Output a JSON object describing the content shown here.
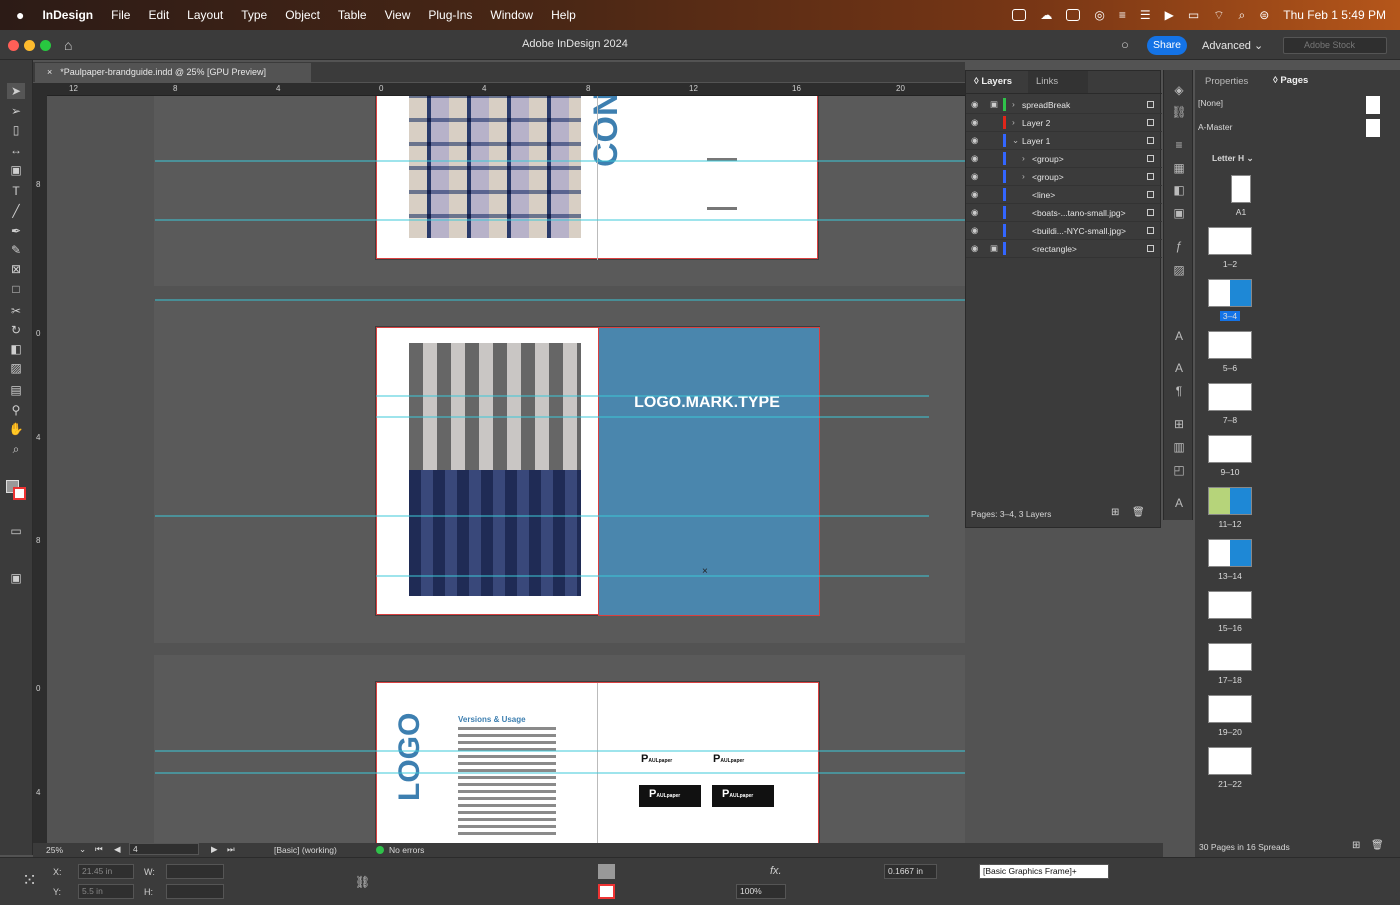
{
  "menubar": {
    "app": "InDesign",
    "items": [
      "File",
      "Edit",
      "Layout",
      "Type",
      "Object",
      "Table",
      "View",
      "Plug-Ins",
      "Window",
      "Help"
    ],
    "clock": "Thu Feb 1  5:49 PM"
  },
  "appbar": {
    "title": "Adobe InDesign 2024",
    "share": "Share",
    "workspace": "Advanced",
    "stock_placeholder": "Adobe Stock"
  },
  "document": {
    "tab": "*Paulpaper-brandguide.indd @ 25% [GPU Preview]"
  },
  "hruler": [
    "12",
    "8",
    "4",
    "0",
    "4",
    "8",
    "12",
    "16",
    "20"
  ],
  "vruler": [
    "8",
    "0",
    "4",
    "8",
    "0",
    "4"
  ],
  "canvas": {
    "cover_word": "CON",
    "logo_text": "LOGO.MARK.TYPE",
    "logo_word": "LOGO",
    "section_title": "Versions & Usage",
    "brand_small": "AULpaper"
  },
  "layers_panel": {
    "tabs": [
      "Layers",
      "Links"
    ],
    "rows": [
      {
        "name": "spreadBreak",
        "color": "#2fc24a",
        "indent": 0,
        "arrow": "›",
        "lock": true
      },
      {
        "name": "Layer 2",
        "color": "#e0261a",
        "indent": 0,
        "arrow": "›",
        "lock": false
      },
      {
        "name": "Layer 1",
        "color": "#3366ff",
        "indent": 0,
        "arrow": "⌄",
        "lock": false
      },
      {
        "name": "<group>",
        "color": "#3366ff",
        "indent": 1,
        "arrow": "›",
        "lock": false
      },
      {
        "name": "<group>",
        "color": "#3366ff",
        "indent": 1,
        "arrow": "›",
        "lock": false
      },
      {
        "name": "<line>",
        "color": "#3366ff",
        "indent": 1,
        "arrow": "",
        "lock": false
      },
      {
        "name": "<boats-...tano-small.jpg>",
        "color": "#3366ff",
        "indent": 1,
        "arrow": "",
        "lock": false
      },
      {
        "name": "<buildi...-NYC-small.jpg>",
        "color": "#3366ff",
        "indent": 1,
        "arrow": "",
        "lock": false
      },
      {
        "name": "<rectangle>",
        "color": "#3366ff",
        "indent": 1,
        "arrow": "",
        "lock": true
      }
    ],
    "status": "Pages: 3–4, 3 Layers"
  },
  "pages_panel": {
    "tabs": [
      "Properties",
      "Pages"
    ],
    "none": "[None]",
    "master": "A-Master",
    "size": "Letter H",
    "thumbs": [
      "A1",
      "1–2",
      "3–4",
      "5–6",
      "7–8",
      "9–10",
      "11–12",
      "13–14",
      "15–16",
      "17–18",
      "19–20",
      "21–22"
    ],
    "status": "30 Pages in 16 Spreads"
  },
  "statusbar": {
    "zoom": "25%",
    "page": "4",
    "profile": "[Basic] (working)",
    "errors": "No errors"
  },
  "control": {
    "x": "21.45 in",
    "y": "5.5 in",
    "x_label": "X:",
    "y_label": "Y:",
    "w_label": "W:",
    "h_label": "H:",
    "stroke": "0.1667 in",
    "scale": "100%",
    "style": "[Basic Graphics Frame]+",
    "fx": "fx."
  }
}
